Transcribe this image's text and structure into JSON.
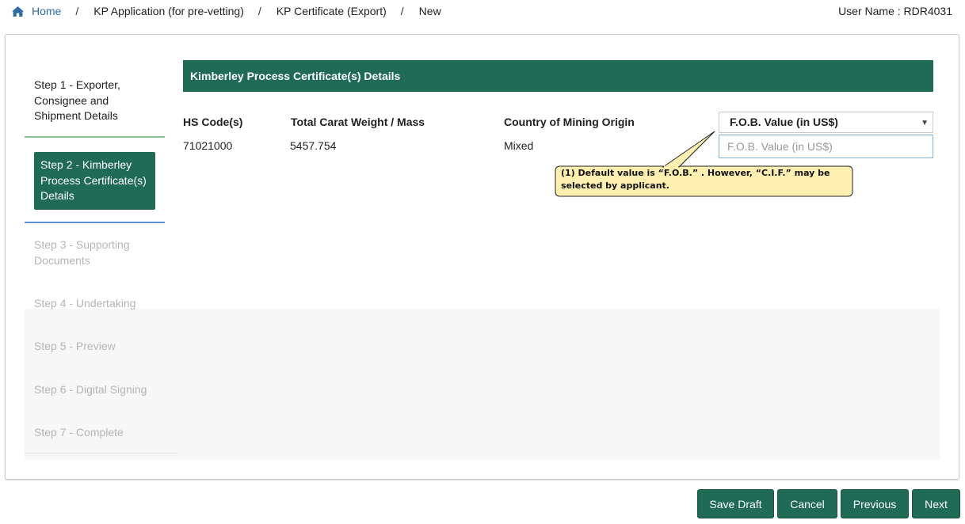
{
  "breadcrumb": {
    "home": "Home",
    "items": [
      "KP Application (for pre-vetting)",
      "KP Certificate (Export)",
      "New"
    ],
    "separator": "/"
  },
  "user": {
    "label": "User Name : RDR4031"
  },
  "steps": [
    {
      "label": "Step 1 - Exporter, Consignee and Shipment Details",
      "state": "done"
    },
    {
      "label": "Step 2 - Kimberley Process Certificate(s) Details",
      "state": "active"
    },
    {
      "label": "Step 3 - Supporting Documents",
      "state": "pending"
    },
    {
      "label": "Step 4 - Undertaking",
      "state": "pending"
    },
    {
      "label": "Step 5 - Preview",
      "state": "pending"
    },
    {
      "label": "Step 6 - Digital Signing",
      "state": "pending"
    },
    {
      "label": "Step 7 - Complete",
      "state": "pending"
    }
  ],
  "section": {
    "title": "Kimberley Process Certificate(s) Details",
    "columns": {
      "hs_code": "HS Code(s)",
      "carat": "Total Carat Weight / Mass",
      "origin": "Country of Mining Origin"
    },
    "row": {
      "hs_code": "71021000",
      "carat": "5457.754",
      "origin": "Mixed"
    },
    "value_type": {
      "selected": "F.O.B. Value (in US$)",
      "input_value": "",
      "input_placeholder": "F.O.B. Value (in US$)"
    }
  },
  "callout": {
    "text": "(1) Default value is “F.O.B.” .  However, “C.I.F.” may be selected by applicant."
  },
  "buttons": {
    "save_draft": "Save Draft",
    "cancel": "Cancel",
    "previous": "Previous",
    "next": "Next"
  },
  "colors": {
    "primary_green": "#1f6b55",
    "link_blue": "#2e6da4",
    "callout_fill": "#ffefb0"
  },
  "icons": {
    "home": "home-icon",
    "select_chevron": "chevron-down-icon"
  }
}
